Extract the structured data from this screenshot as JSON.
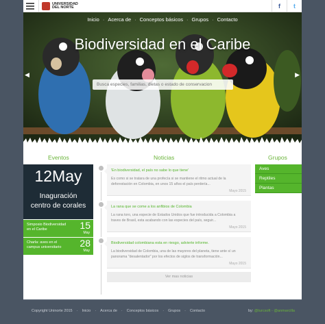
{
  "topbar": {
    "logo_line1": "UNIVERSIDAD",
    "logo_line2": "DEL NORTE",
    "facebook_icon": "f",
    "twitter_icon": "t"
  },
  "nav": [
    "Inicio",
    "Acerca de",
    "Conceptos básicos",
    "Grupos",
    "Contacto"
  ],
  "hero": {
    "title": "Biodiversidad en el Caribe",
    "search_placeholder": "Busca especies, familias, dietas o estado de conservacion",
    "prev_icon": "◀",
    "next_icon": "▶"
  },
  "events": {
    "title": "Eventos",
    "featured_date": "12May",
    "featured_name_1": "Inaguración",
    "featured_name_2": "centro de corales",
    "items": [
      {
        "title": "Simposio Biodiversidad en el Caribe",
        "day": "15",
        "month": "May"
      },
      {
        "title": "Charla: aves en el campus universitario",
        "day": "28",
        "month": "May"
      }
    ]
  },
  "news": {
    "title": "Noticias",
    "items": [
      {
        "title": "'En biodiversidad, el país no sabe lo que tiene'",
        "body": "Es como si se tratara de una profecía si se mantiene el ritmo actual de la deforestación en Colombia, en unos 15 años el país perdería...",
        "date": "Mayo 2015"
      },
      {
        "title": "La rana que se come a los anfibios de Colombia",
        "body": "La rana toro, una especie de Estados Unidos que fue introducida a Colombia a traves de Brasil, esta acabando con las especies del país, seguir...",
        "date": "Mayo 2015"
      },
      {
        "title": "Biodiversidad colombiana esta en riesgo, advierte informe.",
        "body": "La biodiversidad de Colombia, una de las mayores del planeta, tiene ante sí un  panorama \"desalentador\" por los efectos de siglos de transformación...",
        "date": "Mayo 2015"
      }
    ],
    "more_label": "Ver mas noticias"
  },
  "groups": {
    "title": "Grupos",
    "items": [
      "Aves",
      "Reptiles",
      "Plantas"
    ]
  },
  "footer": {
    "copyright": "Copyright Uninorte 2015",
    "links": [
      "Inicio",
      "Acerca de",
      "Conceptos básicos",
      "Grupos",
      "Contacto"
    ],
    "by_label": "by:",
    "authors": "@turcsoft - @anmarcilla"
  },
  "colors": {
    "accent": "#55b52c",
    "background": "#4a5563",
    "event_card": "#1e2c36"
  }
}
